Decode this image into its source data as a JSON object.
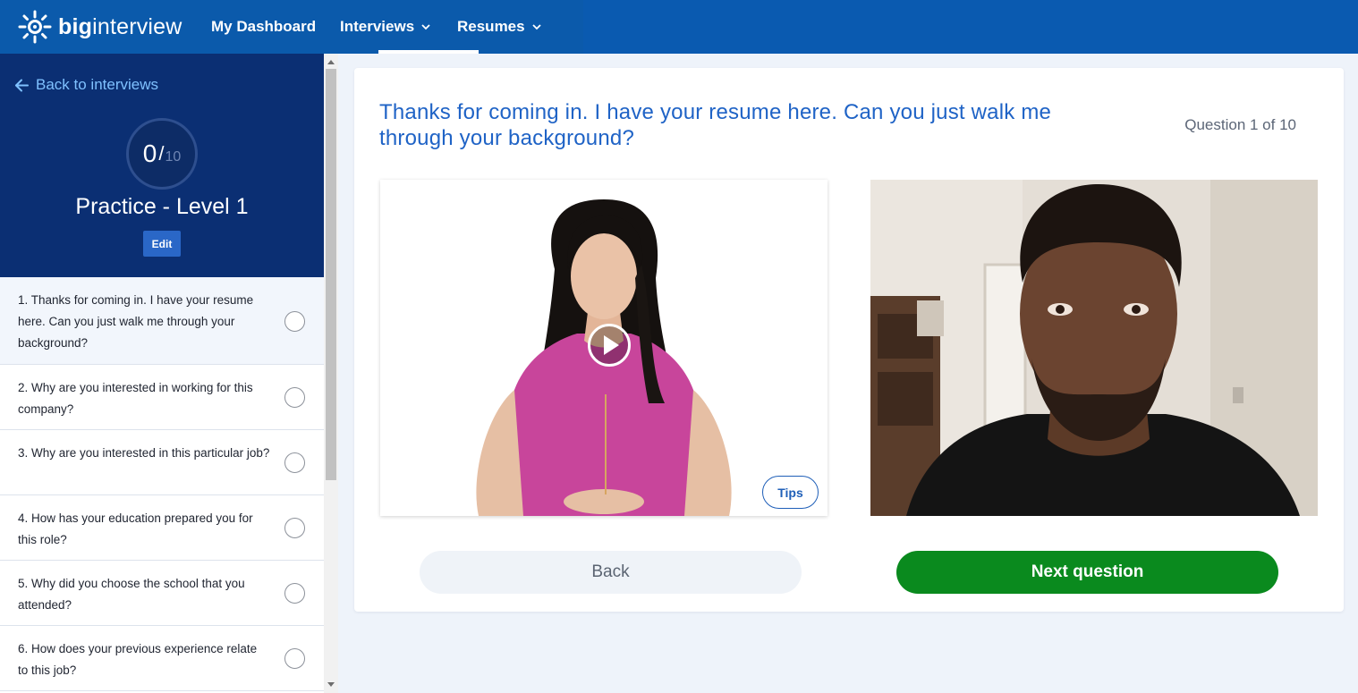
{
  "brand": {
    "logo_bold": "big",
    "logo_light": "interview"
  },
  "nav": {
    "items": [
      {
        "label": "My Dashboard"
      },
      {
        "label": "Interviews"
      },
      {
        "label": "Resumes"
      }
    ]
  },
  "sidebar": {
    "back_label": "Back to interviews",
    "progress": {
      "done": "0",
      "total": "10"
    },
    "title": "Practice - Level 1",
    "edit_label": "Edit",
    "questions": [
      {
        "text": "1. Thanks for coming in. I have your resume here. Can you just walk me through your background?"
      },
      {
        "text": "2. Why are you interested in working for this company?"
      },
      {
        "text": "3. Why are you interested in this particular job?"
      },
      {
        "text": "4. How has your education prepared you for this role?"
      },
      {
        "text": "5. Why did you choose the school that you attended?"
      },
      {
        "text": "6. How does your previous experience relate to this job?"
      }
    ]
  },
  "main": {
    "question": "Thanks for coming in. I have your resume here. Can you just walk me through your background?",
    "question_count": "Question 1 of 10",
    "tips_label": "Tips",
    "back_label": "Back",
    "next_label": "Next question"
  },
  "colors": {
    "nav_bg": "#0a5ab0",
    "sidebar_head": "#0b2f73",
    "question_blue": "#1f63c6",
    "next_green": "#0a8a1e"
  }
}
